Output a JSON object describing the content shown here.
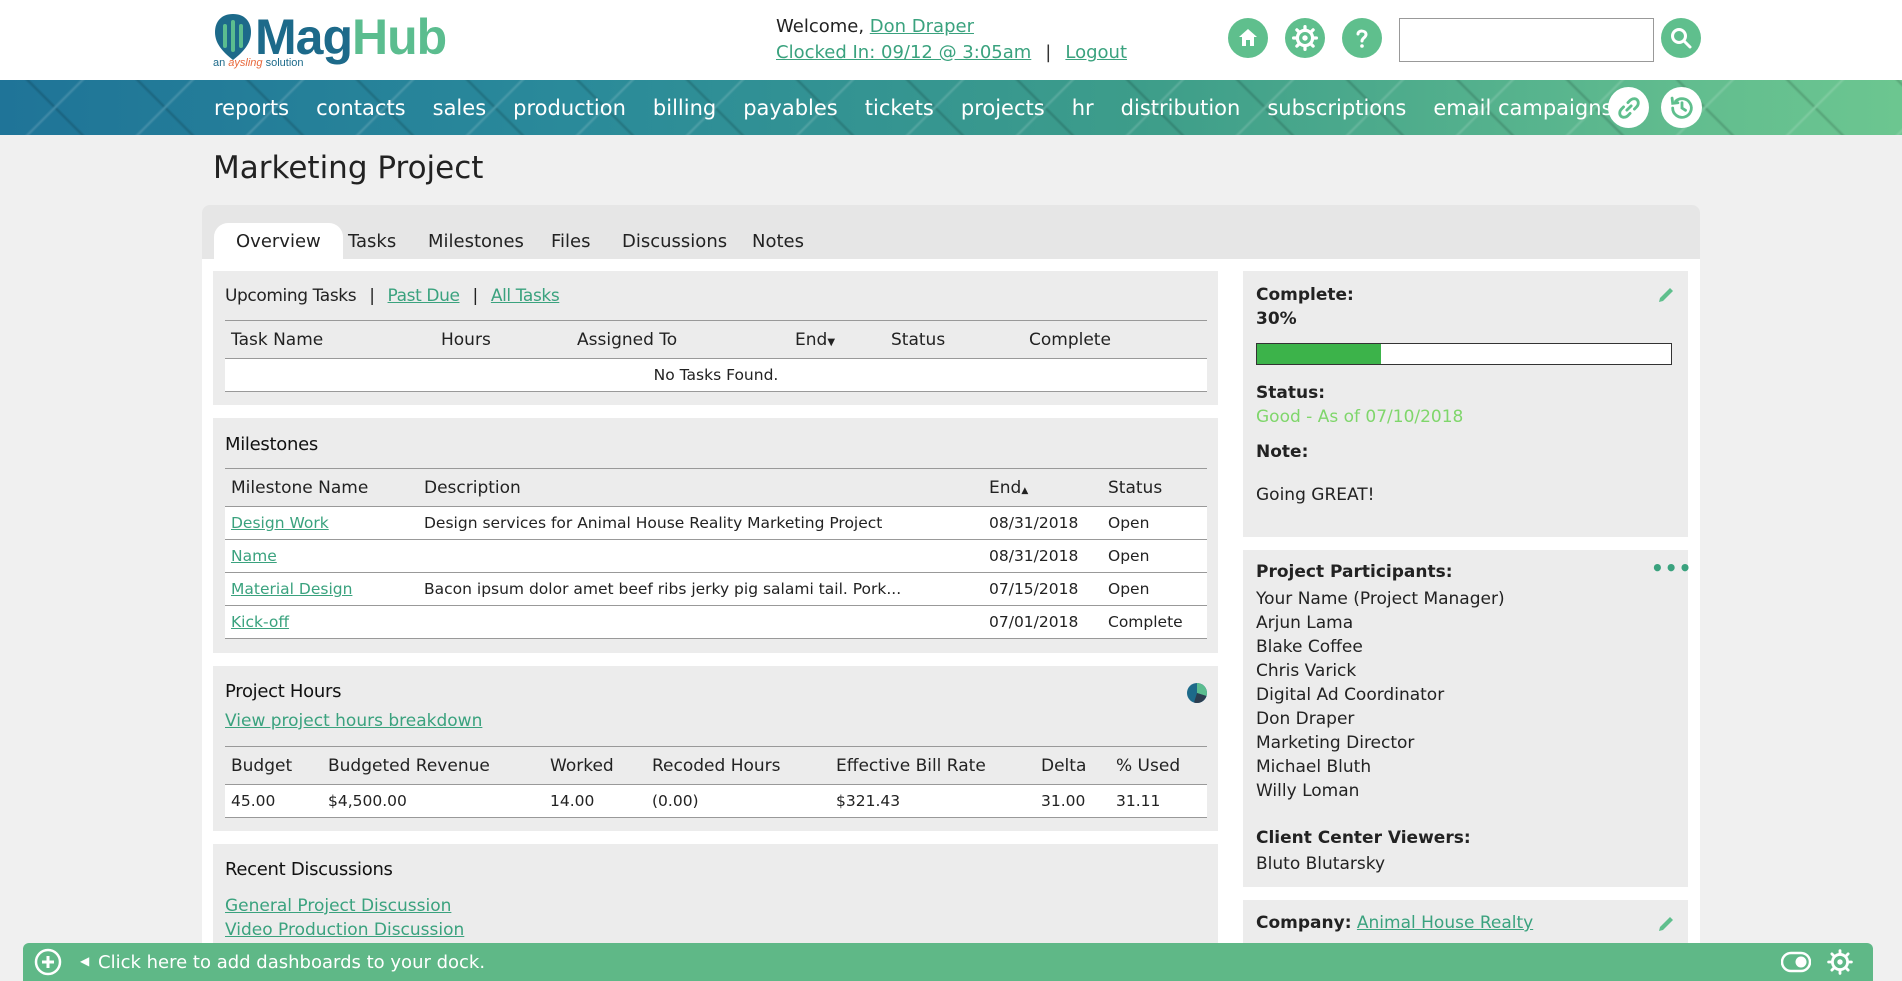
{
  "header": {
    "logo_main_1": "Mag",
    "logo_main_2": "Hub",
    "logo_sub_1": "an ",
    "logo_sub_2": "aysling",
    "logo_sub_3": " solution",
    "welcome_prefix": "Welcome, ",
    "user_name": "Don Draper",
    "clocked_in": "Clocked In: 09/12 @ 3:05am",
    "separator": "|",
    "logout": "Logout",
    "search_placeholder": "",
    "icons": [
      "home-icon",
      "gear-icon",
      "help-icon",
      "search-icon"
    ]
  },
  "nav": {
    "items": [
      "reports",
      "contacts",
      "sales",
      "production",
      "billing",
      "payables",
      "tickets",
      "projects",
      "hr",
      "distribution",
      "subscriptions",
      "email campaigns"
    ],
    "icons": [
      "link-icon",
      "history-icon"
    ]
  },
  "page": {
    "title": "Marketing Project"
  },
  "tabs": [
    "Overview",
    "Tasks",
    "Milestones",
    "Files",
    "Discussions",
    "Notes"
  ],
  "tasks": {
    "filter_active": "Upcoming Tasks",
    "filter_sep": "|",
    "filter_past_due": "Past Due",
    "filter_all": "All Tasks",
    "columns": [
      "Task Name",
      "Hours",
      "Assigned To",
      "End",
      "Status",
      "Complete"
    ],
    "empty_message": "No Tasks Found."
  },
  "milestones": {
    "title": "Milestones",
    "columns": [
      "Milestone Name",
      "Description",
      "End",
      "Status"
    ],
    "rows": [
      {
        "name": "Design Work",
        "description": "Design services for Animal House Reality Marketing Project",
        "end": "08/31/2018",
        "status": "Open"
      },
      {
        "name": "Name",
        "description": "",
        "end": "08/31/2018",
        "status": "Open"
      },
      {
        "name": "Material Design",
        "description": "Bacon ipsum dolor amet beef ribs jerky pig salami tail. Pork...",
        "end": "07/15/2018",
        "status": "Open"
      },
      {
        "name": "Kick-off",
        "description": "",
        "end": "07/01/2018",
        "status": "Complete"
      }
    ]
  },
  "hours": {
    "title": "Project Hours",
    "breakdown_link": "View project hours breakdown",
    "columns": [
      "Budget",
      "Budgeted Revenue",
      "Worked",
      "Recoded Hours",
      "Effective Bill Rate",
      "Delta",
      "% Used"
    ],
    "row": [
      "45.00",
      "$4,500.00",
      "14.00",
      "(0.00)",
      "$321.43",
      "31.00",
      "31.11"
    ]
  },
  "discussions": {
    "title": "Recent Discussions",
    "items": [
      "General Project Discussion",
      "Video Production Discussion"
    ]
  },
  "status_panel": {
    "complete_label": "Complete:",
    "complete_value": "30%",
    "progress_percent": 30,
    "status_label": "Status:",
    "status_value": "Good - As of 07/10/2018",
    "status_color": "#7fd66b",
    "note_label": "Note:",
    "note_value": "Going GREAT!"
  },
  "participants": {
    "title": "Project Participants:",
    "list": [
      "Your Name (Project Manager)",
      "Arjun Lama",
      "Blake Coffee",
      "Chris Varick",
      "Digital Ad Coordinator",
      "Don Draper",
      "Marketing Director",
      "Michael Bluth",
      "Willy Loman"
    ],
    "viewers_label": "Client Center Viewers:",
    "viewers": [
      "Bluto Blutarsky"
    ]
  },
  "company": {
    "label": "Company:",
    "value": "Animal House Realty"
  },
  "dock": {
    "text": "Click here to add dashboards to your dock."
  },
  "colors": {
    "accent": "#3aa27e",
    "nav_start": "#1f7498",
    "nav_end": "#6cc690",
    "icon_bg": "#5fbf8d",
    "progress": "#3cb34a"
  }
}
